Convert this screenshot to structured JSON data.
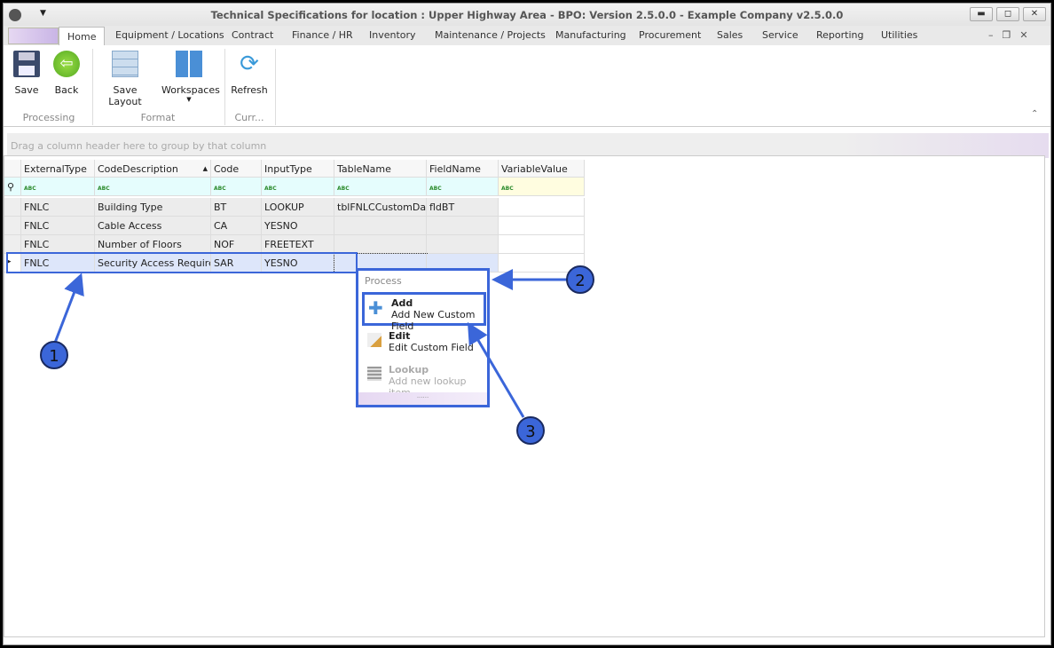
{
  "window": {
    "title": "Technical Specifications for location : Upper Highway Area - BPO: Version 2.5.0.0 - Example Company v2.5.0.0",
    "minimize": "▬",
    "restore": "◻",
    "close": "✕"
  },
  "tabs": [
    "Home",
    "Equipment / Locations",
    "Contract",
    "Finance / HR",
    "Inventory",
    "Maintenance / Projects",
    "Manufacturing",
    "Procurement",
    "Sales",
    "Service",
    "Reporting",
    "Utilities"
  ],
  "ribbon": {
    "buttons": {
      "save": "Save",
      "back": "Back",
      "save_layout": "Save Layout",
      "workspaces": "Workspaces",
      "refresh": "Refresh"
    },
    "groups": {
      "processing": "Processing",
      "format": "Format",
      "current": "Curr..."
    }
  },
  "grid": {
    "group_hint": "Drag a column header here to group by that column",
    "columns": [
      "ExternalType",
      "CodeDescription",
      "Code",
      "InputType",
      "TableName",
      "FieldName",
      "VariableValue"
    ],
    "filter_glyph": "ABC",
    "rows": [
      [
        "FNLC",
        "Building Type",
        "BT",
        "LOOKUP",
        "tblFNLCCustomData",
        "fldBT",
        ""
      ],
      [
        "FNLC",
        "Cable Access",
        "CA",
        "YESNO",
        "",
        "",
        ""
      ],
      [
        "FNLC",
        "Number of Floors",
        "NOF",
        "FREETEXT",
        "",
        "",
        ""
      ],
      [
        "FNLC",
        "Security Access Required",
        "SAR",
        "YESNO",
        "",
        "",
        ""
      ]
    ]
  },
  "context_menu": {
    "header": "Process",
    "items": [
      {
        "title": "Add",
        "subtitle": "Add New Custom Field",
        "icon": "plus-icon",
        "enabled": true
      },
      {
        "title": "Edit",
        "subtitle": "Edit Custom Field",
        "icon": "edit-icon",
        "enabled": true
      },
      {
        "title": "Lookup",
        "subtitle": "Add new lookup item",
        "icon": "list-icon",
        "enabled": false
      }
    ]
  },
  "annotations": [
    "1",
    "2",
    "3"
  ],
  "colors": {
    "accent": "#3b66d9",
    "selected_row": "#dde6fa",
    "filter_row": "#e5fdfd"
  }
}
